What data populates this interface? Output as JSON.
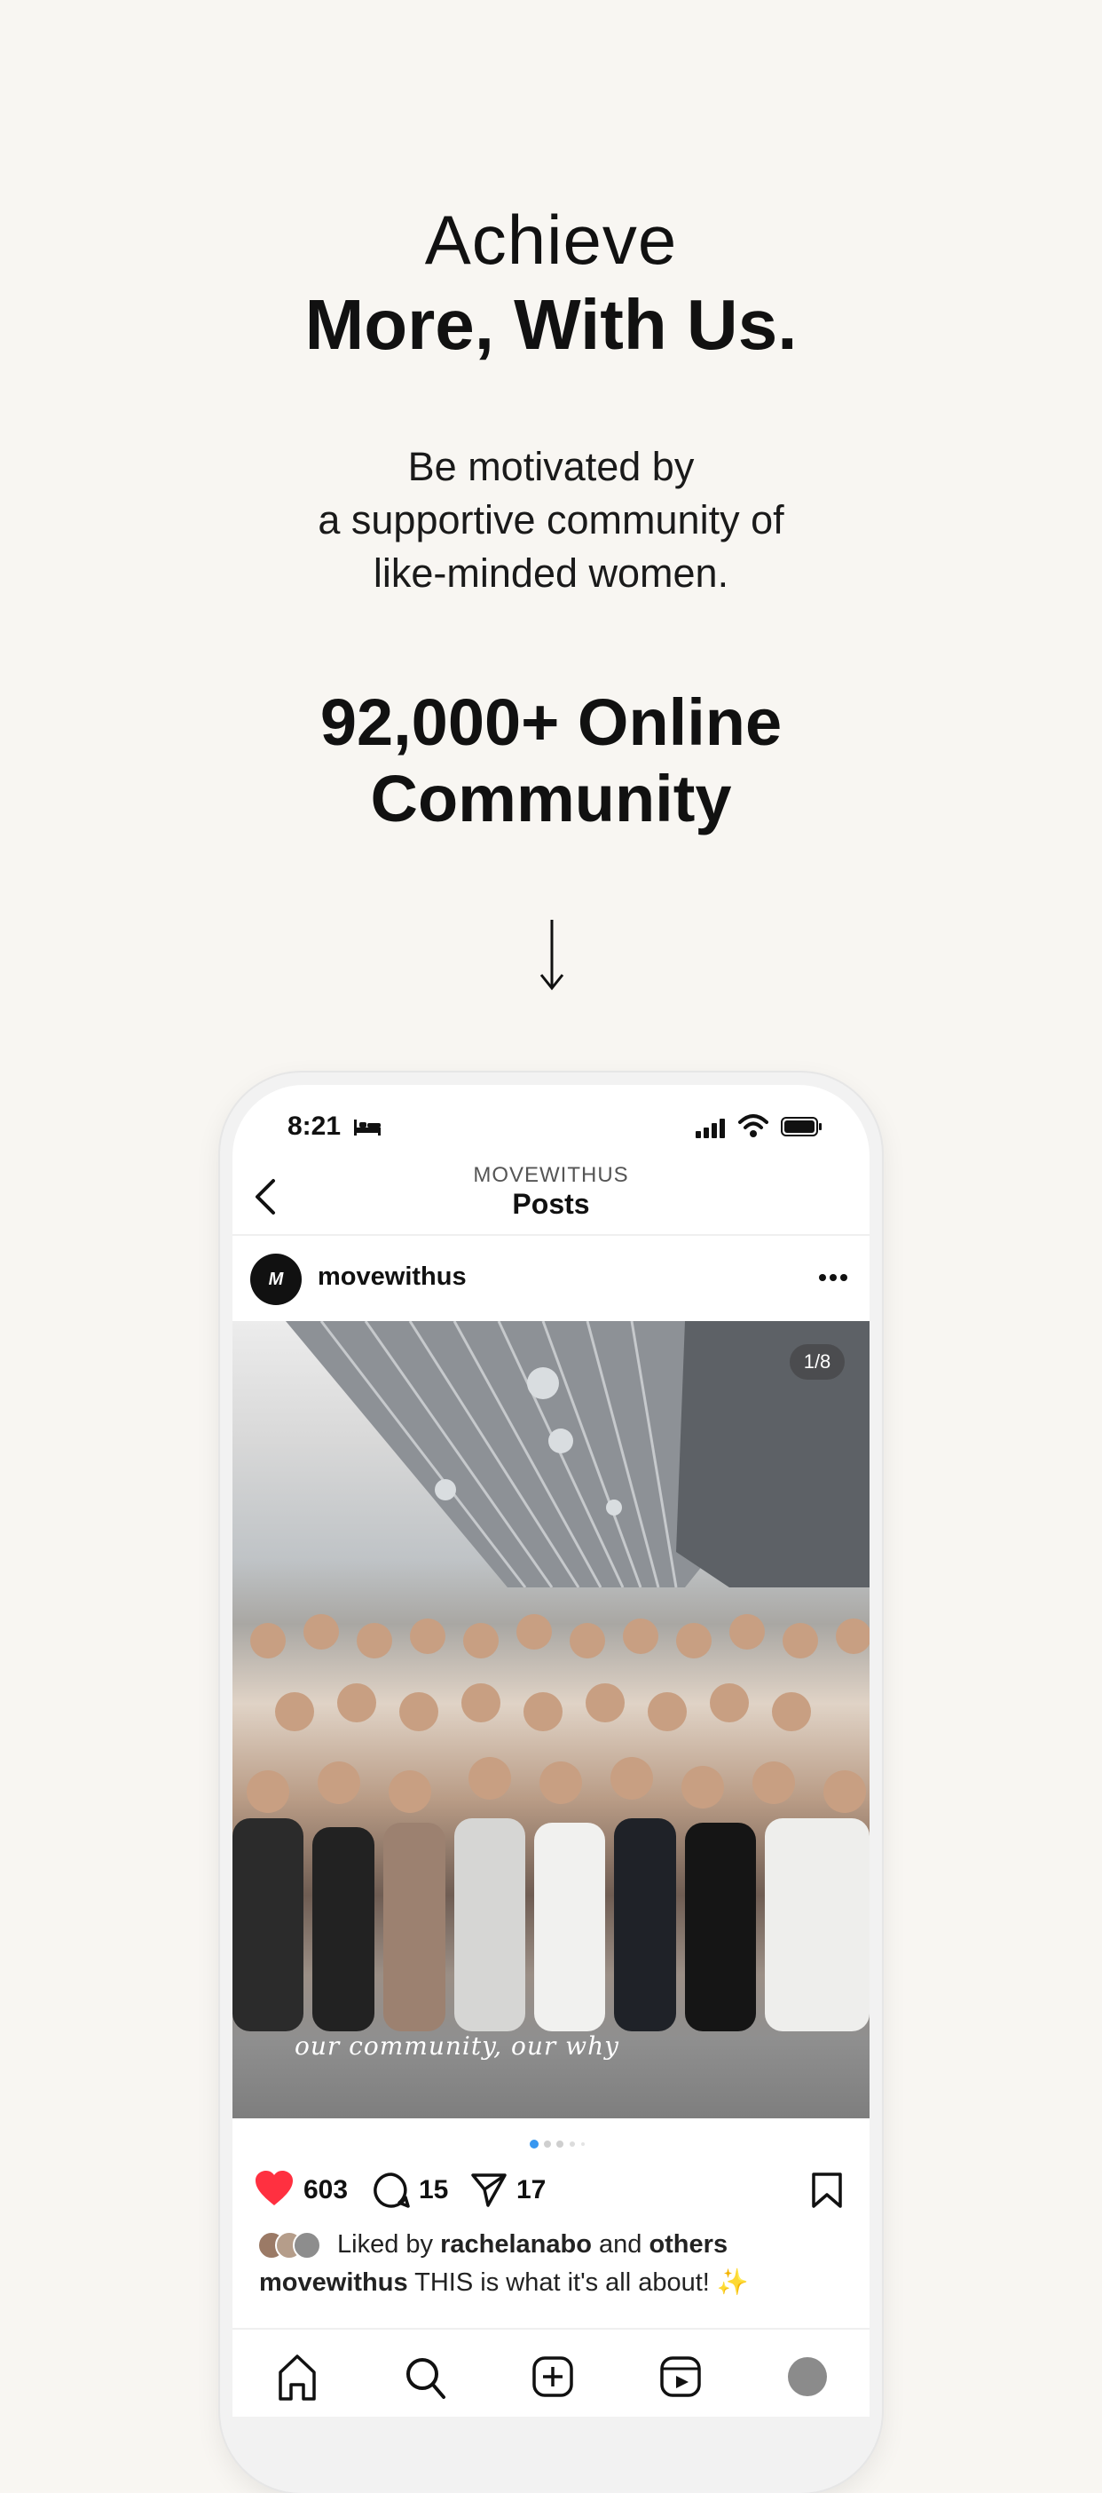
{
  "hero": {
    "line1": "Achieve",
    "line2": "More, With Us.",
    "sub1": "Be motivated by",
    "sub2": "a supportive community of",
    "sub3": "like-minded women.",
    "count1": "92,000+ Online",
    "count2": "Community"
  },
  "phone": {
    "status": {
      "time": "8:21"
    },
    "nav": {
      "subtitle": "MOVEWITHUS",
      "title": "Posts"
    },
    "post": {
      "avatar_mark": "M",
      "username": "movewithus",
      "image_counter": "1/8",
      "image_caption": "our community, our why",
      "likes": "603",
      "comments": "15",
      "shares": "17",
      "liked_by_prefix": "Liked by",
      "liked_by_user": "rachelanabo",
      "liked_by_and": "and",
      "liked_by_others": "others",
      "caption_user": "movewithus",
      "caption_text": "THIS is what it's all about! ✨"
    }
  },
  "colors": {
    "background": "#f8f6f2",
    "heart": "#ff3040",
    "dot_active": "#3897f0"
  },
  "icons": [
    "bed-icon",
    "signal-icon",
    "wifi-icon",
    "battery-icon",
    "back-icon",
    "more-icon",
    "heart-icon",
    "comment-icon",
    "share-icon",
    "bookmark-icon",
    "home-icon",
    "search-icon",
    "create-icon",
    "reels-icon",
    "profile-icon",
    "down-arrow-icon"
  ]
}
